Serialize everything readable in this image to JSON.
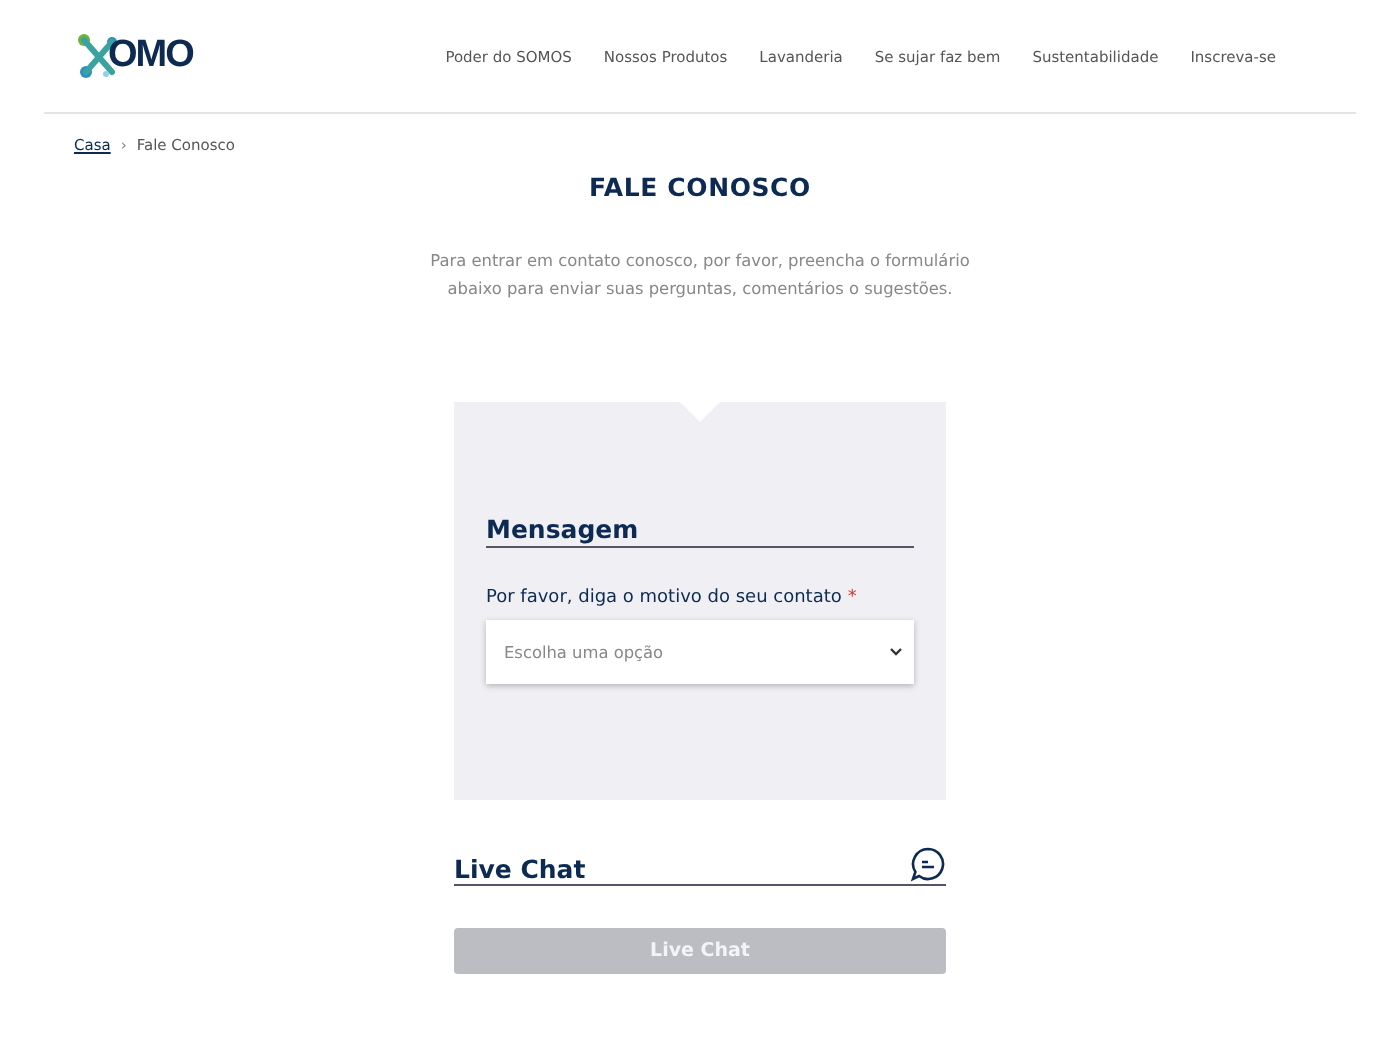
{
  "header": {
    "logo": "OMO",
    "nav": [
      "Poder do SOMOS",
      "Nossos Produtos",
      "Lavanderia",
      "Se sujar faz bem",
      "Sustentabilidade",
      "Inscreva-se"
    ]
  },
  "breadcrumb": {
    "link": "Casa",
    "separator": "›",
    "current": "Fale Conosco"
  },
  "title": "FALE CONOSCO",
  "intro": "Para entrar em contato conosco, por favor, preencha o formulário abaixo para enviar suas perguntas, comentários o sugestões.",
  "form": {
    "heading": "Mensagem",
    "label": "Por favor, diga o motivo do seu contato",
    "required": true,
    "required_mark": "*",
    "select": {
      "placeholder": "Escolha uma opção"
    }
  },
  "live_chat": {
    "heading": "Live Chat",
    "button": {
      "label": "Live Chat",
      "disabled": true
    }
  }
}
